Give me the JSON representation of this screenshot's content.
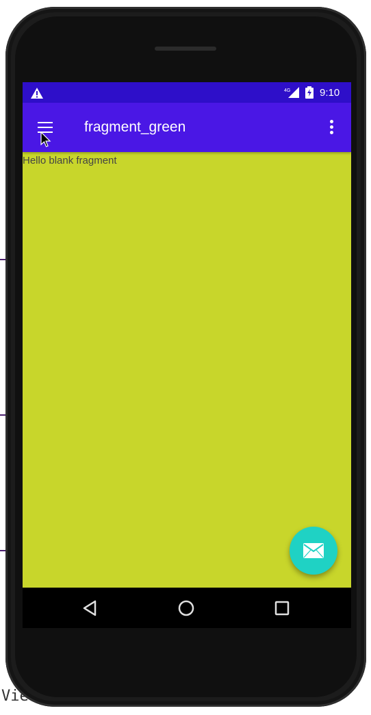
{
  "status_bar": {
    "time": "9:10",
    "icons": [
      "warning-icon",
      "signal-4g-icon",
      "battery-charging-icon"
    ]
  },
  "app_bar": {
    "title": "fragment_green",
    "nav_icon": "menu-icon",
    "action_icon": "overflow-menu-icon"
  },
  "content": {
    "text": "Hello blank fragment",
    "background_color": "#c8d62b"
  },
  "fab": {
    "icon": "email-icon",
    "color": "#1fd2c4"
  },
  "nav_bar": {
    "icons": [
      "back-icon",
      "home-icon",
      "recents-icon"
    ]
  },
  "background_ide": {
    "visible_text": "View"
  },
  "colors": {
    "status_bar": "#2e0fc9",
    "app_bar": "#4a17e5"
  }
}
